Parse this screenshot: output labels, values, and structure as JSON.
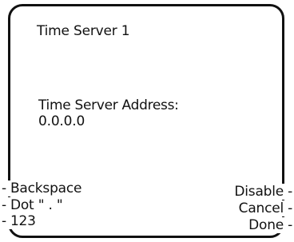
{
  "screen": {
    "title": "Time Server 1",
    "field_label": "Time Server Address:",
    "field_value": "0.0.0.0"
  },
  "softkeys": {
    "dash": "-",
    "left": [
      "Backspace",
      "Dot \" . \"",
      "123"
    ],
    "right": [
      "Disable",
      "Cancel",
      "Done"
    ]
  }
}
